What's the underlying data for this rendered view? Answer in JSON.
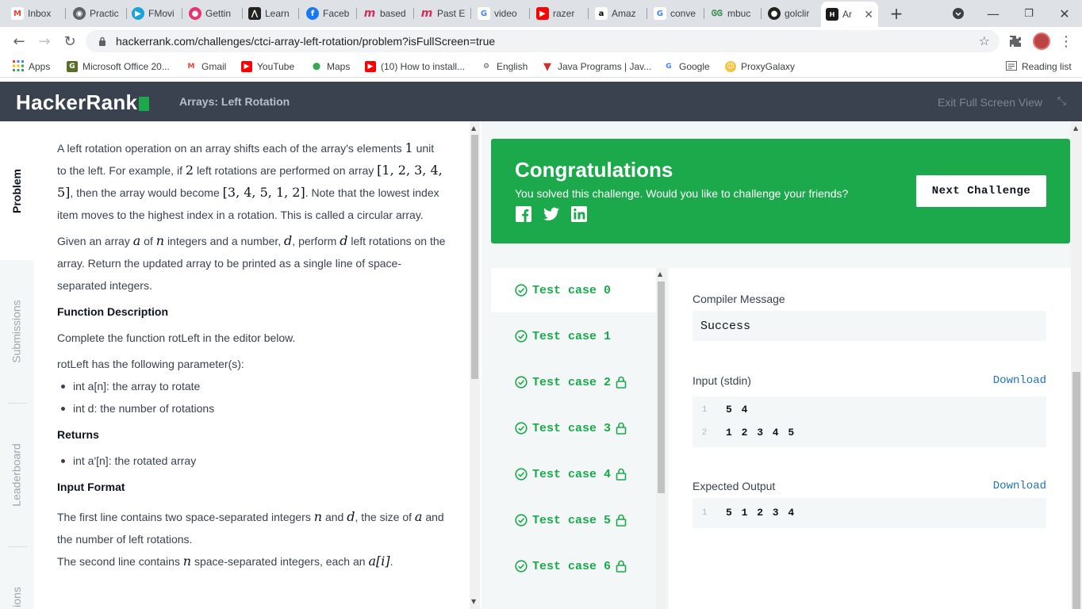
{
  "browser": {
    "tabs": [
      {
        "label": "Inbox",
        "icon": "gmail-icon"
      },
      {
        "label": "Practic",
        "icon": "globe-icon"
      },
      {
        "label": "FMovi",
        "icon": "play-icon"
      },
      {
        "label": "Gettin",
        "icon": "video-icon"
      },
      {
        "label": "Learn",
        "icon": "learn-icon"
      },
      {
        "label": "Faceb",
        "icon": "facebook-icon"
      },
      {
        "label": "based",
        "icon": "m-icon"
      },
      {
        "label": "Past E",
        "icon": "m-icon"
      },
      {
        "label": "video",
        "icon": "google-icon"
      },
      {
        "label": "razer",
        "icon": "youtube-icon"
      },
      {
        "label": "Amaz",
        "icon": "amazon-icon"
      },
      {
        "label": "conve",
        "icon": "google-icon"
      },
      {
        "label": "mbuc",
        "icon": "gfg-icon"
      },
      {
        "label": "golclir",
        "icon": "github-icon"
      },
      {
        "label": "Ar",
        "icon": "hackerrank-icon"
      }
    ],
    "url": "hackerrank.com/challenges/ctci-array-left-rotation/problem?isFullScreen=true",
    "bookmarks": [
      {
        "label": "Apps"
      },
      {
        "label": "Microsoft Office 20..."
      },
      {
        "label": "Gmail"
      },
      {
        "label": "YouTube"
      },
      {
        "label": "Maps"
      },
      {
        "label": "(10) How to install..."
      },
      {
        "label": "English"
      },
      {
        "label": "Java Programs | Jav..."
      },
      {
        "label": "Google"
      },
      {
        "label": "ProxyGalaxy"
      }
    ],
    "reading_list": "Reading list"
  },
  "header": {
    "logo": "HackerRank",
    "title": "Arrays: Left Rotation",
    "exit": "Exit Full Screen View"
  },
  "sidetabs": {
    "problem": "Problem",
    "submissions": "Submissions",
    "leaderboard": "Leaderboard",
    "discussions": "ions"
  },
  "problem": {
    "p1a": "A left rotation operation on an array shifts each of the array's elements",
    "p1_one": "1",
    "p1b": "unit to the left. For example, if",
    "p1_two": "2",
    "p1c": "left rotations are performed on array",
    "p1_arr1": "[1, 2, 3, 4, 5]",
    "p1d": ", then the array would become",
    "p1_arr2": "[3, 4, 5, 1, 2]",
    "p1e": ". Note that the lowest index item moves to the highest index in a rotation. This is called a circular array.",
    "p2a": "Given an array",
    "p2_a": "a",
    "p2b": "of",
    "p2_n": "n",
    "p2c": "integers and a number,",
    "p2_d": "d",
    "p2d": ", perform",
    "p2_d2": "d",
    "p2e": "left rotations on the array. Return the updated array to be printed as a single line of space-separated integers.",
    "fd_heading": "Function Description",
    "fd_text": "Complete the function rotLeft in the editor below.",
    "params_text": "rotLeft has the following parameter(s):",
    "param1": "int a[n]: the array to rotate",
    "param2": "int d: the number of rotations",
    "returns_heading": "Returns",
    "returns1": "int a'[n]: the rotated array",
    "if_heading": "Input Format",
    "if1a": "The first line contains two space-separated integers",
    "if1_n": "n",
    "if1b": "and",
    "if1_d": "d",
    "if1c": ", the size of",
    "if1_a": "a",
    "if1d": "and the number of left rotations.",
    "if2a": "The second line contains",
    "if2_n": "n",
    "if2b": "space-separated integers, each an",
    "if2_ai": "a[i]",
    "if2c": "."
  },
  "congrats": {
    "title": "Congratulations",
    "subtitle": "You solved this challenge. Would you like to challenge your friends?",
    "next": "Next Challenge"
  },
  "testcases": [
    {
      "label": "Test case 0",
      "locked": false
    },
    {
      "label": "Test case 1",
      "locked": false
    },
    {
      "label": "Test case 2",
      "locked": true
    },
    {
      "label": "Test case 3",
      "locked": true
    },
    {
      "label": "Test case 4",
      "locked": true
    },
    {
      "label": "Test case 5",
      "locked": true
    },
    {
      "label": "Test case 6",
      "locked": true
    }
  ],
  "result": {
    "compiler_label": "Compiler Message",
    "compiler_value": "Success",
    "input_label": "Input (stdin)",
    "download": "Download",
    "input_lines": [
      {
        "n": "1",
        "code": "5 4"
      },
      {
        "n": "2",
        "code": "1 2 3 4 5"
      }
    ],
    "expected_label": "Expected Output",
    "expected_lines": [
      {
        "n": "1",
        "code": "5 1 2 3 4"
      }
    ]
  },
  "colors": {
    "accent": "#1ba94c",
    "header_bg": "#39424e"
  }
}
